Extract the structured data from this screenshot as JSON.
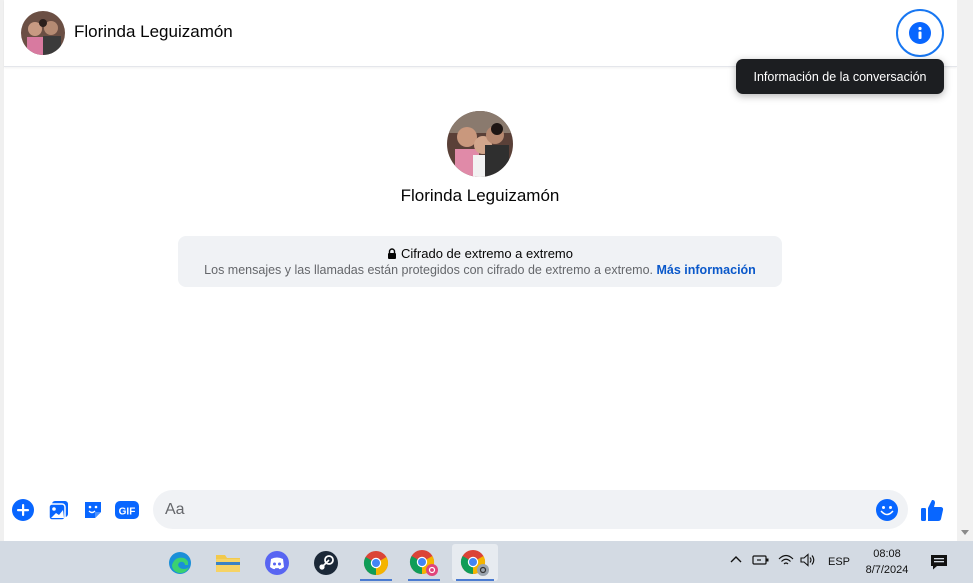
{
  "header": {
    "contact_name": "Florinda Leguizamón",
    "info_tooltip": "Información de la conversación"
  },
  "profile": {
    "name": "Florinda Leguizamón"
  },
  "encryption": {
    "title": "Cifrado de extremo a extremo",
    "description": "Los mensajes y las llamadas están protegidos con cifrado de extremo a extremo.",
    "link": "Más información"
  },
  "composer": {
    "placeholder": "Aa",
    "actions": [
      "plus-icon",
      "image-icon",
      "sticker-icon",
      "gif-icon"
    ],
    "gif_label": "GIF"
  },
  "colors": {
    "accent": "#0866ff",
    "tooltip_bg": "#1c1e21",
    "bubble_bg": "#f0f2f5",
    "taskbar_bg": "#d3dae3"
  },
  "taskbar": {
    "apps": [
      "edge-icon",
      "file-explorer-icon",
      "discord-icon",
      "steam-icon",
      "chrome-icon",
      "chrome-profile-icon",
      "chrome-profile-active-icon"
    ],
    "language": "ESP",
    "time": "08:08",
    "date": "8/7/2024"
  }
}
